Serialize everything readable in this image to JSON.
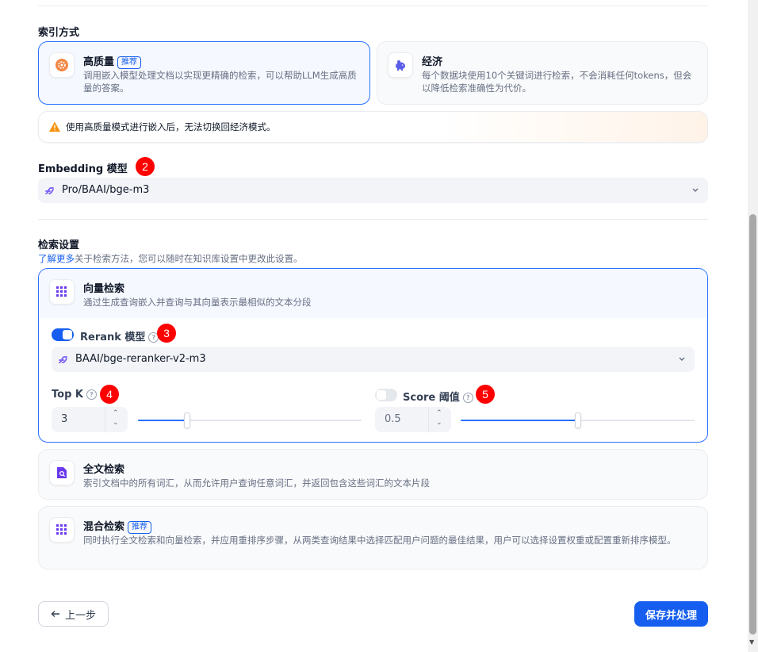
{
  "index_method": {
    "title": "索引方式",
    "high_quality": {
      "title": "高质量",
      "badge": "推荐",
      "desc": "调用嵌入模型处理文档以实现更精确的检索，可以帮助LLM生成高质量的答案。"
    },
    "economy": {
      "title": "经济",
      "desc": "每个数据块使用10个关键词进行检索，不会消耗任何tokens，但会以降低检索准确性为代价。"
    },
    "warning": "使用高质量模式进行嵌入后，无法切换回经济模式。"
  },
  "embedding": {
    "title": "Embedding 模型",
    "marker": "2",
    "model": "Pro/BAAI/bge-m3"
  },
  "retrieval": {
    "title": "检索设置",
    "learn_more": "了解更多",
    "desc": "关于检索方法，您可以随时在知识库设置中更改此设置。",
    "vector": {
      "title": "向量检索",
      "desc": "通过生成查询嵌入并查询与其向量表示最相似的文本分段"
    },
    "rerank": {
      "label": "Rerank 模型",
      "marker": "3",
      "enabled": true,
      "model": "BAAI/bge-reranker-v2-m3"
    },
    "topk": {
      "label": "Top K",
      "marker": "4",
      "value": "3",
      "slider_fraction": 0.22
    },
    "score": {
      "label": "Score 阈值",
      "marker": "5",
      "enabled": false,
      "value": "0.5",
      "slider_fraction": 0.5
    },
    "fulltext": {
      "title": "全文检索",
      "desc": "索引文档中的所有词汇，从而允许用户查询任意词汇，并返回包含这些词汇的文本片段"
    },
    "hybrid": {
      "title": "混合检索",
      "badge": "推荐",
      "desc": "同时执行全文检索和向量检索，并应用重排序步骤，从两类查询结果中选择匹配用户问题的最佳结果，用户可以选择设置权重或配置重新排序模型。"
    }
  },
  "footer": {
    "back_label": "上一步",
    "save_label": "保存并处理"
  },
  "colors": {
    "accent": "#155eef",
    "marker": "#ff0000",
    "warning": "#f79009"
  }
}
